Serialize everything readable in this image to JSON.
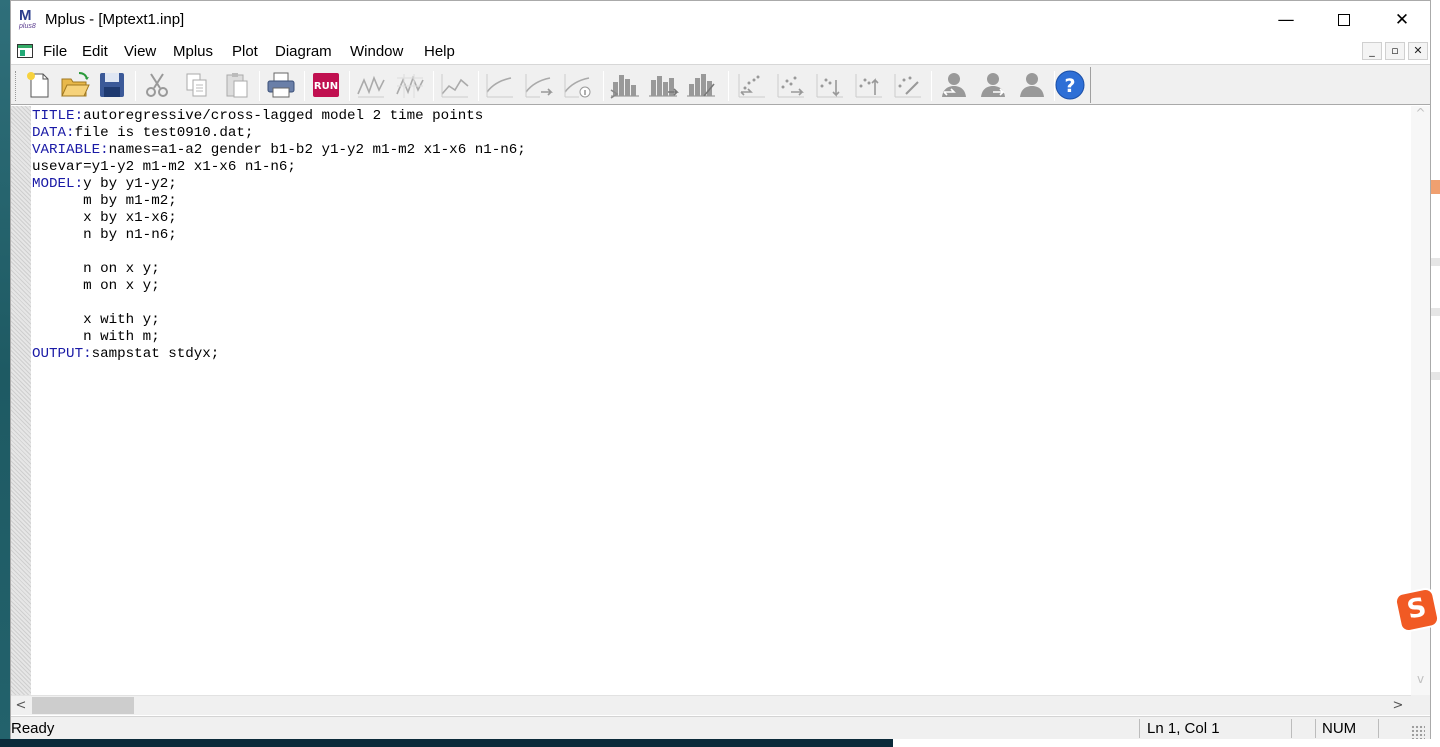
{
  "window": {
    "title": "Mplus - [Mptext1.inp]",
    "app_icon_text": "M",
    "app_icon_subtext": "plus8",
    "caption": {
      "minimize": "—",
      "close": "✕"
    }
  },
  "menubar": {
    "items": [
      {
        "id": "file",
        "label": "File"
      },
      {
        "id": "edit",
        "label": "Edit"
      },
      {
        "id": "view",
        "label": "View"
      },
      {
        "id": "mplus",
        "label": "Mplus"
      },
      {
        "id": "plot",
        "label": "Plot"
      },
      {
        "id": "diagram",
        "label": "Diagram"
      },
      {
        "id": "window",
        "label": "Window"
      },
      {
        "id": "help",
        "label": "Help"
      }
    ],
    "mdi": {
      "minimize": "_",
      "restore": "▫",
      "close": "✕"
    }
  },
  "toolbar": {
    "run_label": "RUN",
    "help_label": "?",
    "buttons": [
      "new-file-icon",
      "open-folder-icon",
      "save-icon",
      "cut-icon",
      "copy-icon",
      "paste-icon",
      "print-icon",
      "run-icon",
      "plot-icon",
      "plot-icon",
      "plot-icon",
      "plot-icon",
      "plot-icon",
      "plot-icon",
      "histogram-icon",
      "histogram-icon",
      "histogram-icon",
      "scatter-icon",
      "scatter-icon",
      "scatter-icon",
      "scatter-icon",
      "scatter-icon",
      "user-icon",
      "user-icon",
      "user-icon",
      "help-icon"
    ]
  },
  "editor": {
    "lines": [
      {
        "kw": "TITLE:",
        "text": "autoregressive/cross-lagged model 2 time points"
      },
      {
        "kw": "DATA:",
        "text": "file is test0910.dat;"
      },
      {
        "kw": "VARIABLE:",
        "text": "names=a1-a2 gender b1-b2 y1-y2 m1-m2 x1-x6 n1-n6;"
      },
      {
        "kw": "",
        "text": "usevar=y1-y2 m1-m2 x1-x6 n1-n6;"
      },
      {
        "kw": "MODEL:",
        "text": "y by y1-y2;"
      },
      {
        "kw": "",
        "text": "      m by m1-m2;"
      },
      {
        "kw": "",
        "text": "      x by x1-x6;"
      },
      {
        "kw": "",
        "text": "      n by n1-n6;"
      },
      {
        "kw": "",
        "text": ""
      },
      {
        "kw": "",
        "text": "      n on x y;"
      },
      {
        "kw": "",
        "text": "      m on x y;"
      },
      {
        "kw": "",
        "text": ""
      },
      {
        "kw": "",
        "text": "      x with y;"
      },
      {
        "kw": "",
        "text": "      n with m;"
      },
      {
        "kw": "OUTPUT:",
        "text": "sampstat stdyx;"
      }
    ]
  },
  "scrollbars": {
    "left": "<",
    "right": ">",
    "up": "^",
    "down": "v"
  },
  "statusbar": {
    "ready": "Ready",
    "position": "Ln 1, Col 1",
    "num": "NUM"
  },
  "overlay": {
    "sogou_text": "S"
  },
  "colors": {
    "keyword": "#1a1aa6",
    "toolbar_bg": "#f0f0f0",
    "accent_run": "#c01050"
  }
}
